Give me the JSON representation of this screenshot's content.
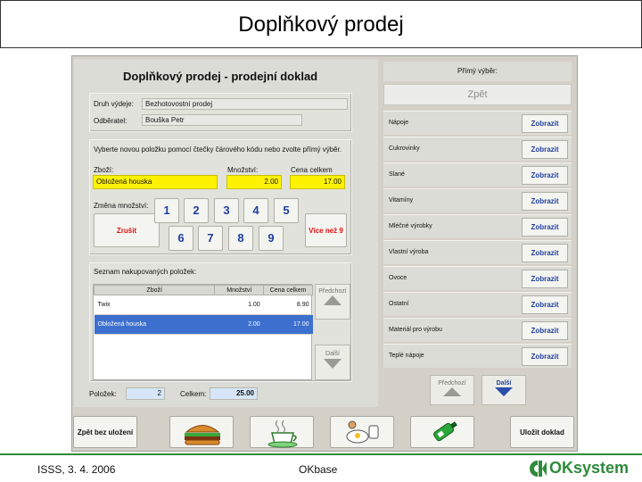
{
  "slide": {
    "title": "Doplňkový prodej",
    "footer_date": "ISSS, 3. 4. 2006",
    "footer_center": "OKbase",
    "footer_logo": "OKsystem"
  },
  "doc": {
    "title": "Doplňkový prodej - prodejní doklad",
    "druh_label": "Druh výdeje:",
    "druh_value": "Bezhotovostní prodej",
    "odberatel_label": "Odběratel:",
    "odberatel_value": "Bouška Petr"
  },
  "scan": {
    "instruction": "Vyberte novou položku pomocí čtečky čárového kódu nebo zvolte přímý výběr.",
    "zbozi_label": "Zboží:",
    "zbozi_value": "Obložená houska",
    "mnozstvi_label": "Množství:",
    "mnozstvi_value": "2.00",
    "cena_label": "Cena celkem",
    "cena_value": "17.00",
    "zmena_label": "Změna množství:",
    "zrusit": "Zrušit",
    "vice": "Více než 9",
    "keys_top": [
      "1",
      "2",
      "3",
      "4",
      "5"
    ],
    "keys_bottom": [
      "6",
      "7",
      "8",
      "9"
    ]
  },
  "items": {
    "title": "Seznam nakupovaných položek:",
    "columns": [
      "Zboží",
      "Množství",
      "Cena celkem"
    ],
    "rows": [
      {
        "name": "Twix",
        "qty": "1.00",
        "price": "8.90"
      },
      {
        "name": "Obložená houska",
        "qty": "2.00",
        "price": "17.00"
      }
    ],
    "prev": "Předchozí",
    "next": "Další",
    "polozek_label": "Položek:",
    "polozek_value": "2",
    "celkem_label": "Celkem:",
    "celkem_value": "25.00"
  },
  "right": {
    "header": "Přímý výběr:",
    "zpet": "Zpět",
    "button_label": "Zobrazit",
    "categories": [
      "Nápoje",
      "Cukrovinky",
      "Slané",
      "Vitamíny",
      "Mléčné výrobky",
      "Vlastní výroba",
      "Ovoce",
      "Ostatní",
      "Materiál pro výrobu",
      "Teplé nápoje"
    ],
    "prev": "Předchozí",
    "next": "Další"
  },
  "bottom": {
    "back_no_save": "Zpět bez uložení",
    "save": "Uložit doklad",
    "icons": [
      "burger-icon",
      "coffee-icon",
      "breakfast-icon",
      "drink-bottle-icon"
    ]
  },
  "colors": {
    "selection": "#3c6fce",
    "key_text": "#1f3f9f",
    "field_highlight": "#fff200",
    "cancel_text": "#e01010",
    "logo_green": "#2e8b3a"
  }
}
